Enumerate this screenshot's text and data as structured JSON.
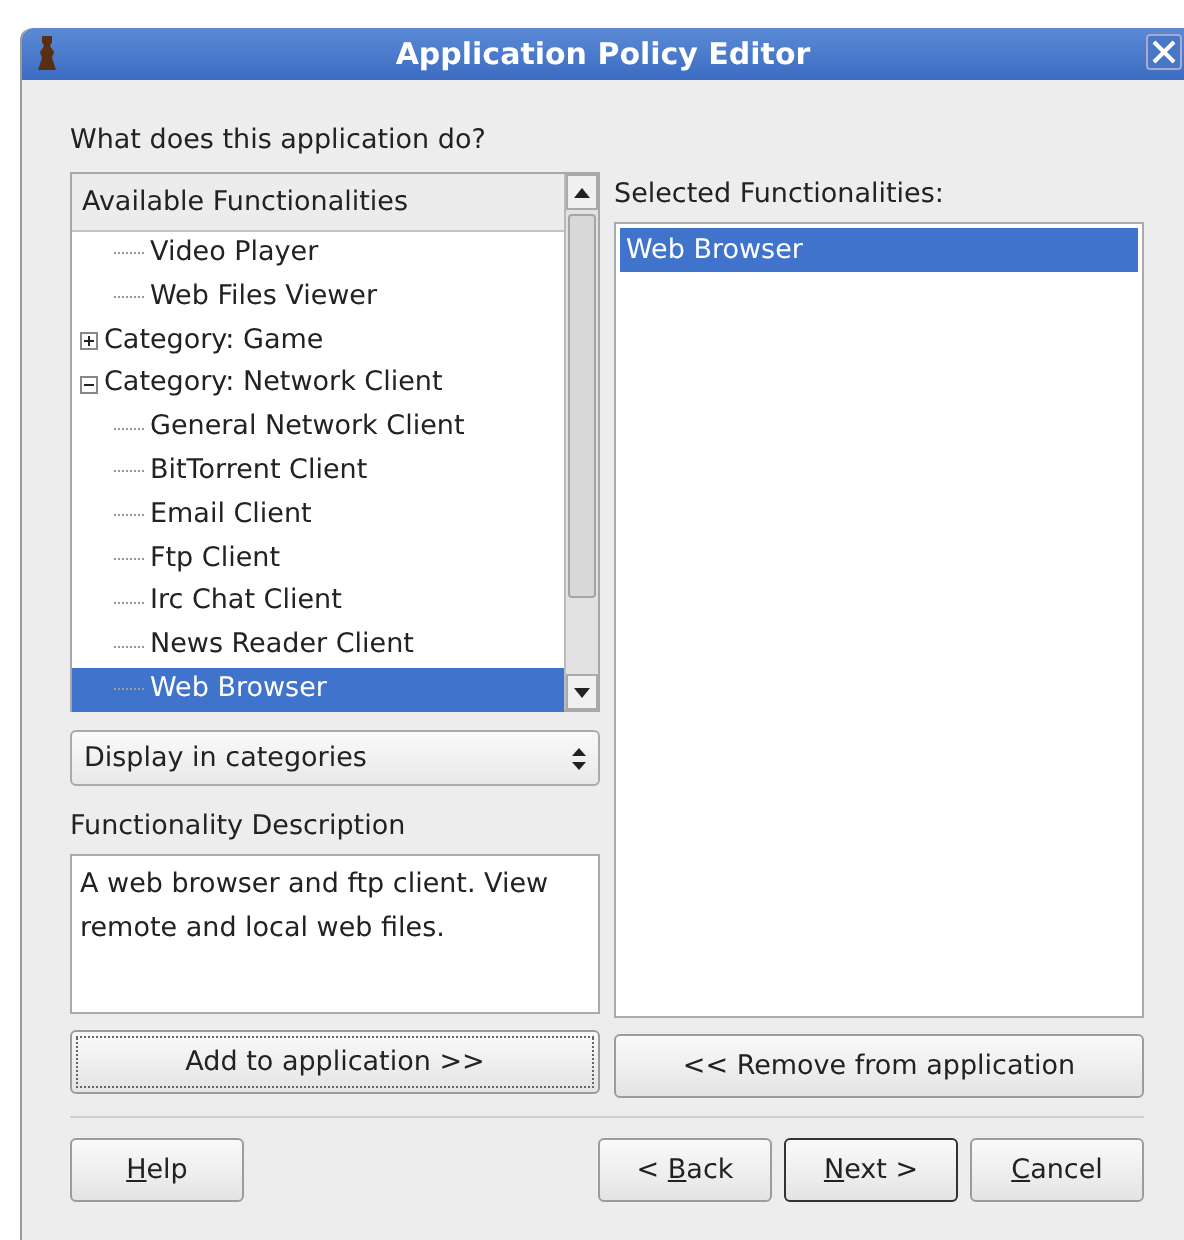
{
  "window": {
    "title": "Application Policy Editor"
  },
  "question": "What does this application do?",
  "available": {
    "header": "Available Functionalities",
    "items": [
      {
        "children": [
          {
            "label": "Video Player",
            "selected": false
          },
          {
            "label": "Web Files Viewer",
            "selected": false
          }
        ]
      },
      {
        "label": "Category: Game",
        "expanded": false,
        "selected": false
      },
      {
        "label": "Category: Network Client",
        "expanded": true,
        "selected": false,
        "children": [
          {
            "label": "General Network Client",
            "selected": false
          },
          {
            "label": "BitTorrent Client",
            "selected": false
          },
          {
            "label": "Email Client",
            "selected": false
          },
          {
            "label": "Ftp Client",
            "selected": false
          },
          {
            "label": "Irc Chat Client",
            "selected": false
          },
          {
            "label": "News Reader Client",
            "selected": false
          },
          {
            "label": "Web Browser",
            "selected": true
          }
        ]
      }
    ]
  },
  "display_mode": {
    "value": "Display in categories"
  },
  "description": {
    "label": "Functionality Description",
    "text": "A web browser and ftp client. View remote and local web files."
  },
  "selected": {
    "label": "Selected Functionalities:",
    "items": [
      {
        "label": "Web Browser",
        "selected": true
      }
    ]
  },
  "add_button": {
    "label": "Add to application >>",
    "focused": true
  },
  "remove_button": {
    "label": "<< Remove from application",
    "focused": false
  },
  "footer_buttons": [
    {
      "mnemonic": "H",
      "rest": "elp",
      "default": false
    },
    {
      "prefix": "< ",
      "mnemonic": "B",
      "rest": "ack",
      "default": false
    },
    {
      "mnemonic": "N",
      "rest": "ext >",
      "default": true
    },
    {
      "mnemonic": "C",
      "rest": "ancel",
      "default": false
    }
  ]
}
